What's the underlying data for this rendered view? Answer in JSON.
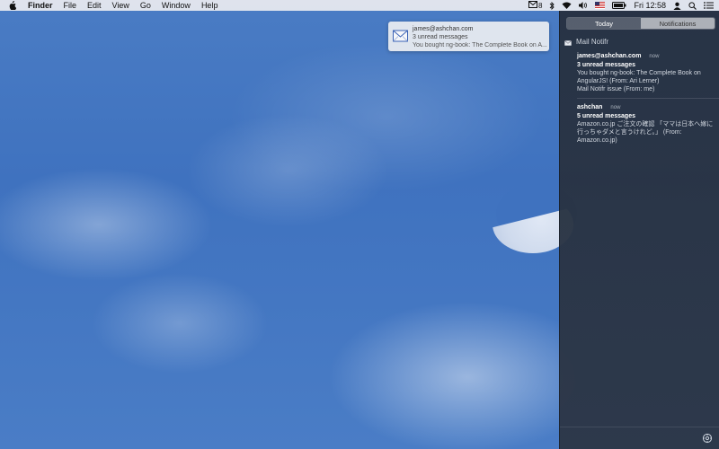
{
  "menubar": {
    "app_name": "Finder",
    "menus": [
      "File",
      "Edit",
      "View",
      "Go",
      "Window",
      "Help"
    ],
    "status": {
      "mail_count": "8",
      "clock": "Fri 12:58"
    }
  },
  "banner": {
    "account": "james@ashchan.com",
    "subtitle": "3 unread messages",
    "body": "You bought ng-book: The Complete Book on A..."
  },
  "panel": {
    "tabs": [
      {
        "label": "Today",
        "active": true
      },
      {
        "label": "Notifications",
        "active": false
      }
    ],
    "section_title": "Mail Notifr",
    "entries": [
      {
        "account": "james@ashchan.com",
        "time": "now",
        "count": "3 unread messages",
        "lines": [
          "You bought ng-book: The Complete Book on",
          "AngularJS! (From: Ari Lerner)",
          "Mail Notifr issue (From: me)"
        ]
      },
      {
        "account": "ashchan",
        "time": "now",
        "count": "5 unread messages",
        "lines": [
          "Amazon.co.jp ご注文の確認 「ママは日本へ嫁に",
          "行っちゃダメと言うけれど。」 (From:",
          "Amazon.co.jp)"
        ]
      }
    ]
  },
  "icons": {
    "apple": "apple-icon",
    "mail": "mail-icon",
    "bluetooth": "bluetooth-icon",
    "wifi": "wifi-icon",
    "volume": "volume-icon",
    "flag": "us-flag-icon",
    "battery": "battery-icon",
    "user": "user-icon",
    "spotlight": "search-icon",
    "notification_center": "notification-center-icon",
    "settings": "gear-icon"
  }
}
